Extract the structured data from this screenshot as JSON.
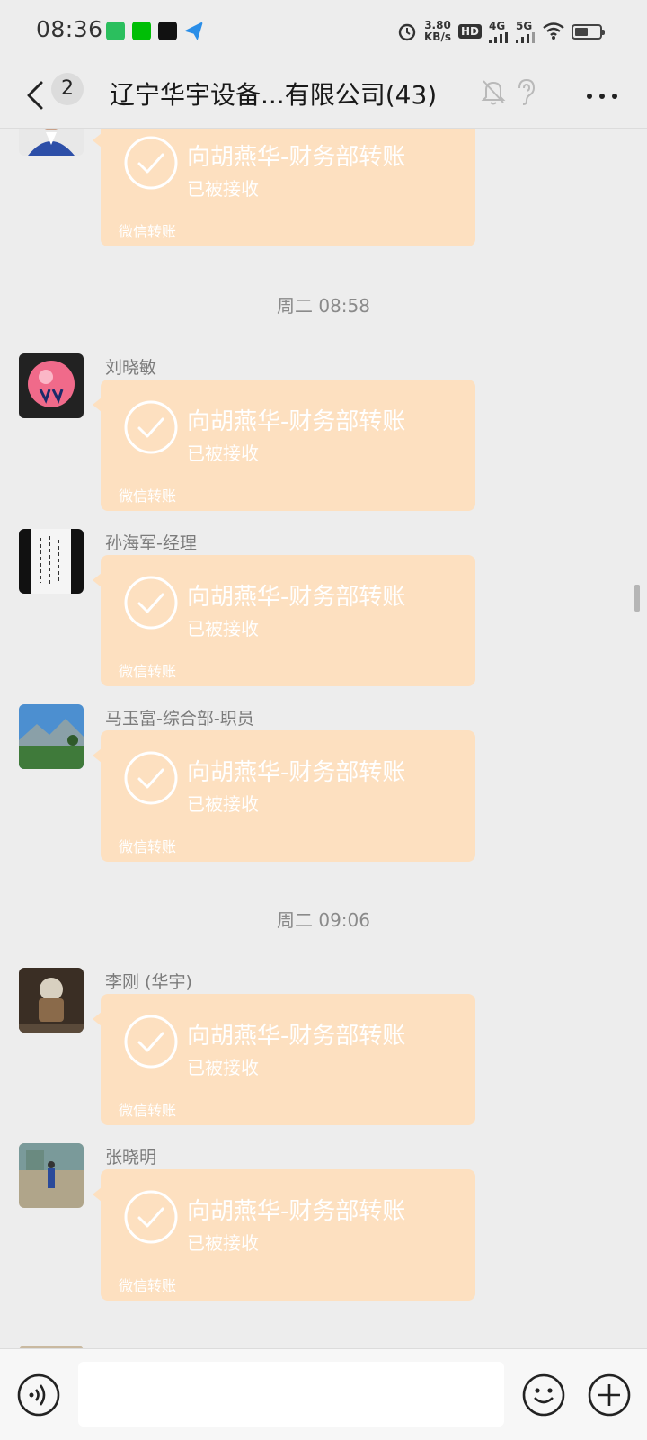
{
  "status_bar": {
    "time": "08:36",
    "net_speed_value": "3.80",
    "net_speed_unit": "KB/s",
    "hd_label": "HD",
    "network_1": "4G",
    "network_2": "5G",
    "battery_level": 0.55,
    "app_icons": [
      "video-app-icon",
      "iqiyi-app-icon",
      "douyin-app-icon",
      "messenger-app-icon"
    ]
  },
  "header": {
    "back_label": "",
    "unread_count": "2",
    "title": "辽宁华宇设备...有限公司(43)",
    "icons": [
      "mute-icon",
      "ear-icon",
      "more-icon"
    ]
  },
  "messages": [
    {
      "sender": "",
      "transfer_title": "向胡燕华-财务部转账",
      "status": "已被接收",
      "footer": "微信转账",
      "avatar_colors": [
        "#2d4fa8",
        "#e8e8e8"
      ]
    },
    {
      "timestamp": "周二 08:58"
    },
    {
      "sender": "刘晓敏",
      "transfer_title": "向胡燕华-财务部转账",
      "status": "已被接收",
      "footer": "微信转账",
      "avatar_colors": [
        "#222222",
        "#f06a8a"
      ]
    },
    {
      "sender": "孙海军-经理",
      "transfer_title": "向胡燕华-财务部转账",
      "status": "已被接收",
      "footer": "微信转账",
      "avatar_colors": [
        "#111111",
        "#f5f5f5"
      ]
    },
    {
      "sender": "马玉富-综合部-职员",
      "transfer_title": "向胡燕华-财务部转账",
      "status": "已被接收",
      "footer": "微信转账",
      "avatar_colors": [
        "#4c8fd0",
        "#3f7a3a"
      ]
    },
    {
      "timestamp": "周二 09:06"
    },
    {
      "sender": "李刚 (华宇)",
      "transfer_title": "向胡燕华-财务部转账",
      "status": "已被接收",
      "footer": "微信转账",
      "avatar_colors": [
        "#3a2e24",
        "#8a6a4a"
      ]
    },
    {
      "sender": "张晓明",
      "transfer_title": "向胡燕华-财务部转账",
      "status": "已被接收",
      "footer": "微信转账",
      "avatar_colors": [
        "#7a9a9a",
        "#b0a58a"
      ]
    }
  ],
  "input_bar": {
    "placeholder": "",
    "icons": [
      "voice-icon",
      "emoji-icon",
      "plus-icon"
    ]
  },
  "colors": {
    "background": "#ededed",
    "transfer_bubble": "#fde0c0",
    "transfer_text": "#ffffff"
  }
}
